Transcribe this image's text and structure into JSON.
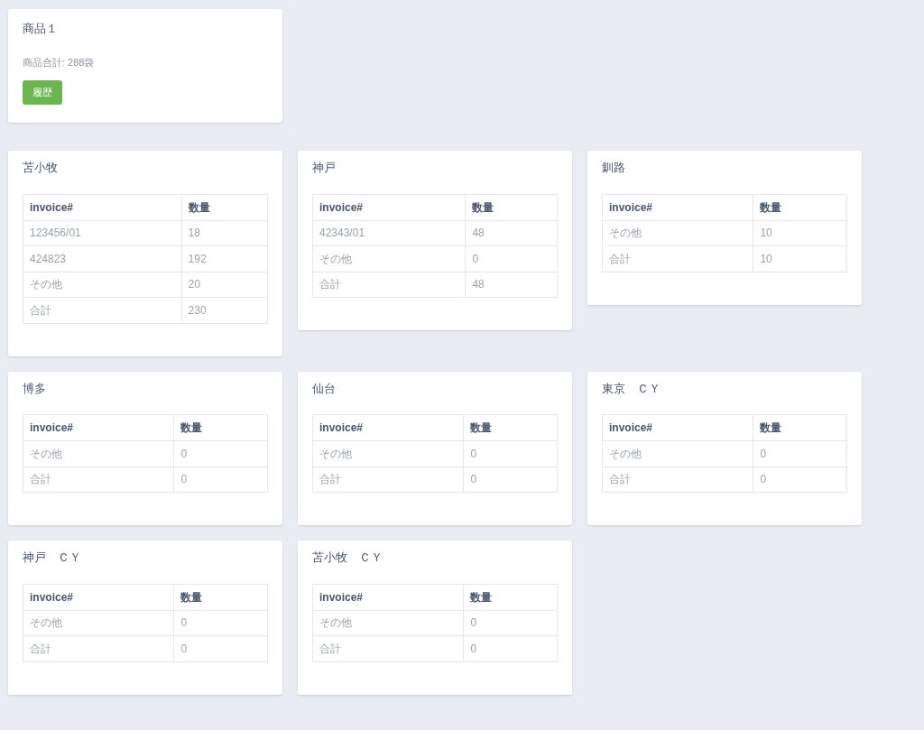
{
  "product": {
    "title": "商品１",
    "total": "商品合計: 288袋",
    "button": "履歴"
  },
  "locations": [
    {
      "title": "苫小牧",
      "columns": [
        "invoice#",
        "数量"
      ],
      "rows": [
        [
          "123456/01",
          "18"
        ],
        [
          "424823",
          "192"
        ],
        [
          "その他",
          "20"
        ],
        [
          "合計",
          "230"
        ]
      ]
    },
    {
      "title": "神戸",
      "columns": [
        "invoice#",
        "数量"
      ],
      "rows": [
        [
          "42343/01",
          "48"
        ],
        [
          "その他",
          "0"
        ],
        [
          "合計",
          "48"
        ]
      ]
    },
    {
      "title": "釧路",
      "columns": [
        "invoice#",
        "数量"
      ],
      "rows": [
        [
          "その他",
          "10"
        ],
        [
          "合計",
          "10"
        ]
      ]
    },
    {
      "title": "博多",
      "columns": [
        "invoice#",
        "数量"
      ],
      "rows": [
        [
          "その他",
          "0"
        ],
        [
          "合計",
          "0"
        ]
      ]
    },
    {
      "title": "仙台",
      "columns": [
        "invoice#",
        "数量"
      ],
      "rows": [
        [
          "その他",
          "0"
        ],
        [
          "合計",
          "0"
        ]
      ]
    },
    {
      "title": "東京　ＣＹ",
      "columns": [
        "invoice#",
        "数量"
      ],
      "rows": [
        [
          "その他",
          "0"
        ],
        [
          "合計",
          "0"
        ]
      ]
    },
    {
      "title": "神戸　ＣＹ",
      "columns": [
        "invoice#",
        "数量"
      ],
      "rows": [
        [
          "その他",
          "0"
        ],
        [
          "合計",
          "0"
        ]
      ]
    },
    {
      "title": "苫小牧　ＣＹ",
      "columns": [
        "invoice#",
        "数量"
      ],
      "rows": [
        [
          "その他",
          "0"
        ],
        [
          "合計",
          "0"
        ]
      ]
    }
  ]
}
